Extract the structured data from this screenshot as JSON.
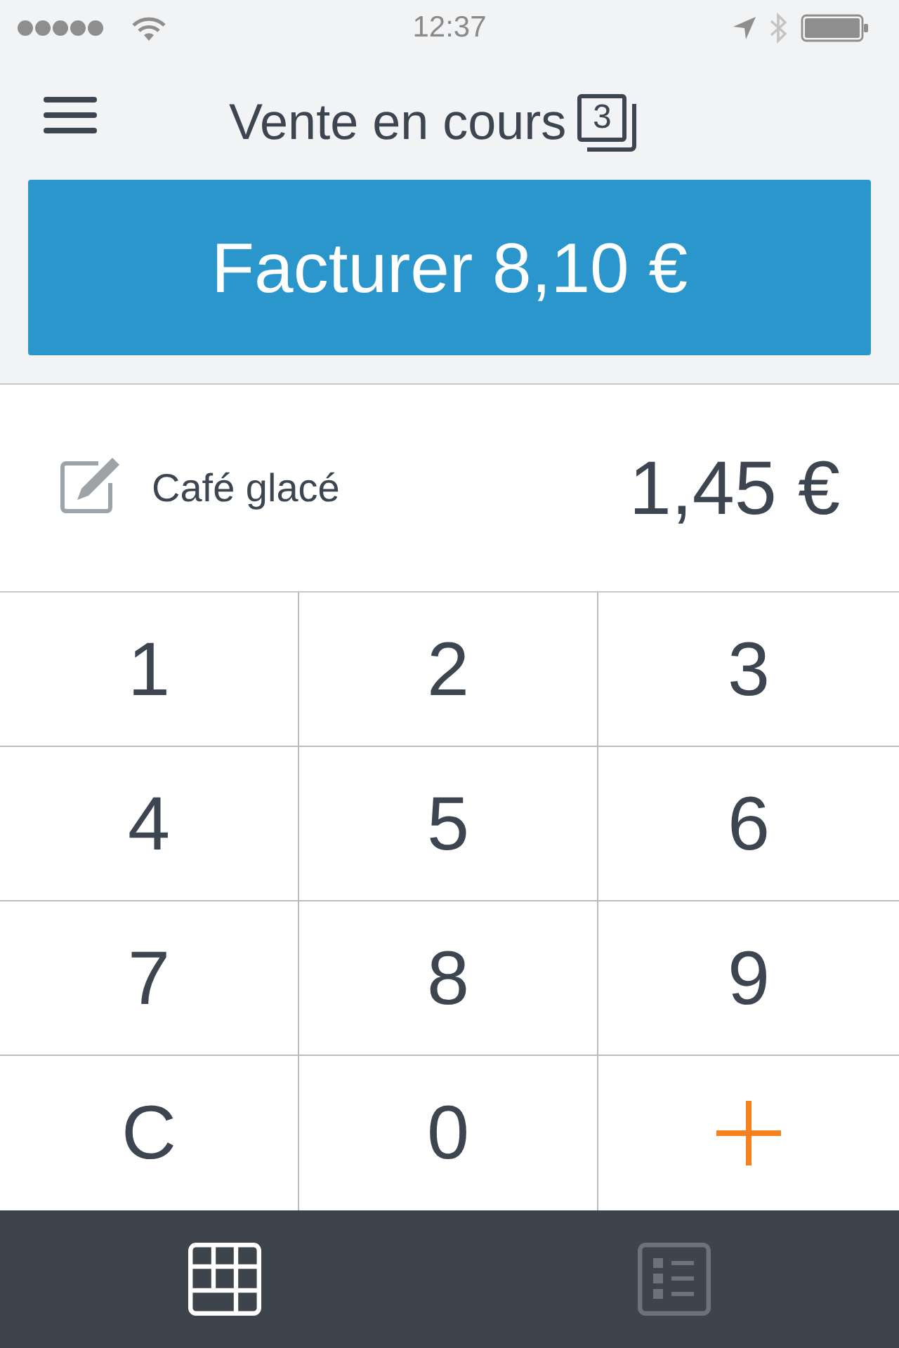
{
  "status_bar": {
    "time": "12:37"
  },
  "header": {
    "title": "Vente en cours",
    "badge": "3"
  },
  "charge_button": {
    "label": "Facturer 8,10 €"
  },
  "current_item": {
    "name": "Café glacé",
    "price": "1,45 €"
  },
  "keypad": [
    {
      "kind": "digit",
      "label": "1"
    },
    {
      "kind": "digit",
      "label": "2"
    },
    {
      "kind": "digit",
      "label": "3"
    },
    {
      "kind": "digit",
      "label": "4"
    },
    {
      "kind": "digit",
      "label": "5"
    },
    {
      "kind": "digit",
      "label": "6"
    },
    {
      "kind": "digit",
      "label": "7"
    },
    {
      "kind": "digit",
      "label": "8"
    },
    {
      "kind": "digit",
      "label": "9"
    },
    {
      "kind": "clear",
      "label": "C"
    },
    {
      "kind": "digit",
      "label": "0"
    },
    {
      "kind": "add"
    }
  ],
  "tabs": [
    {
      "kind": "keypad",
      "selected": true
    },
    {
      "kind": "list",
      "selected": false
    }
  ]
}
